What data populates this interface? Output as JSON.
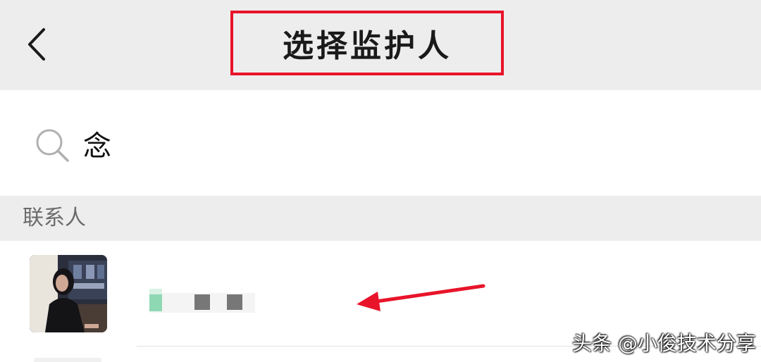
{
  "header": {
    "title": "选择监护人"
  },
  "search": {
    "query": "念",
    "icon": "search-icon"
  },
  "section": {
    "label": "联系人"
  },
  "contacts": [
    {
      "name_display": "",
      "avatar": "contact-photo"
    }
  ],
  "watermark": {
    "text": "头条 @小俊技术分享"
  },
  "colors": {
    "header_bg": "#ededed",
    "highlight_border": "#e8142a",
    "arrow": "#e8142a",
    "section_label": "#6b6b6b"
  }
}
